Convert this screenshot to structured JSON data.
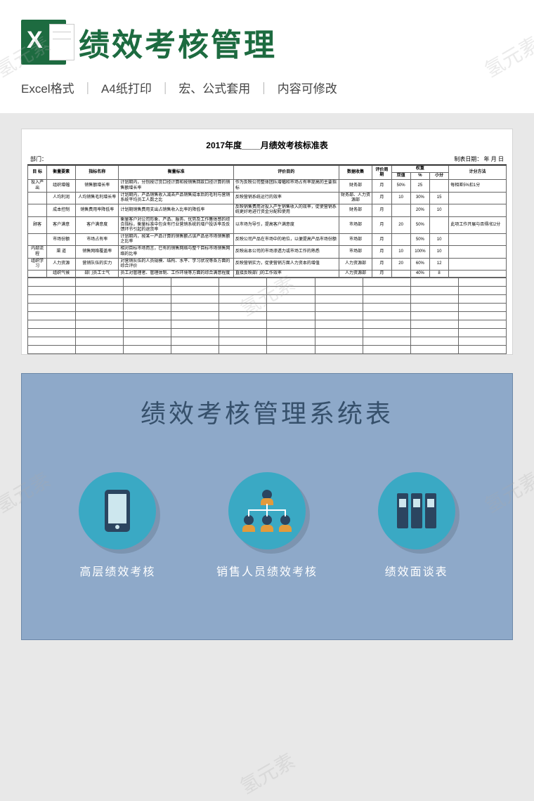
{
  "watermark": "氢元素",
  "header": {
    "icon_letter": "X",
    "title": "绩效考核管理"
  },
  "subhead": {
    "p1": "Excel格式",
    "p2": "A4纸打印",
    "p3": "宏、公式套用",
    "p4": "内容可修改"
  },
  "sheet": {
    "title": "2017年度____月绩效考核标准表",
    "dept_label": "部门：",
    "date_label": "制表日期：      年    月    日",
    "head": {
      "c1": "目 标",
      "c2": "衡量要素",
      "c3": "指标名称",
      "c4": "衡量标准",
      "c5": "评价目的",
      "c6": "数据收集",
      "c7": "评价周期",
      "c8": "权重",
      "c8a": "双值",
      "c8b": "%",
      "c8c": "小分",
      "c9": "计分方法"
    },
    "rows": [
      {
        "g": "投入产出",
        "a": "组织增幅",
        "b": "销售额增长率",
        "c": "计划期内，分别按订货口径计算和按销售回款口径计算的销售额增长率",
        "d": "作为反映公司整体团队增幅和市场占有率提高的主要指标",
        "e": "财务部",
        "f": "月",
        "w1": "50%",
        "w2": "25",
        "m": "每相差5%扣1分"
      },
      {
        "g": "",
        "a": "人均利润",
        "b": "人均销售毛利增长率",
        "c": "计划期内，产品销售收入减去产品销售成本后的毛利与营销系统平均员工人数之比",
        "d": "反映营销系统运行的效率",
        "e": "财务部、人力资源部",
        "f": "月",
        "w1": "10",
        "w2": "30%",
        "m": "15"
      },
      {
        "g": "",
        "a": "成本控制",
        "b": "销售费用率降低率",
        "c": "计划期销售费用支出占销售收入比率的降低率",
        "d": "反映销售费用对投入产生销售收入的效率，促使营销系统更好地进行资金分配和使用",
        "e": "财务部",
        "f": "月",
        "w1": "",
        "w2": "20%",
        "m": "10"
      },
      {
        "g": "顾客",
        "a": "客户满意",
        "b": "客户满意度",
        "c": "衡量客户对公司形象、产品、服务、优势及工作集体感的综合指标，衡量标准中包含有行业营销系统的增户投诉率及反馈环节引起的退货率",
        "d": "以市场为导引，提高客户满意度",
        "e": "市场部",
        "f": "月",
        "w1": "20",
        "w2": "50%",
        "m": "此项工作开展与否得/扣2分"
      },
      {
        "g": "",
        "a": "市场份额",
        "b": "市场占有率",
        "c": "计划期内，按某一产品计算的销售额占该产品总市场销售额之比率",
        "d": "反映公司产品在市场中的地位，以便提高产品市场份额",
        "e": "市场部",
        "f": "月",
        "w1": "",
        "w2": "50%",
        "m": "10"
      },
      {
        "g": "内部流程",
        "a": "渠 道",
        "b": "销售网络覆盖率",
        "c": "相对目标市场而言，已有的销售网络与整个目标市场销售网络的比率",
        "d": "反映出本公司的市场渗透力或市场工作的熟悉",
        "e": "市场部",
        "f": "月",
        "w1": "10",
        "w2": "100%",
        "m": "10"
      },
      {
        "g": "组织学习",
        "a": "人力资源",
        "b": "营销队伍的实力",
        "c": "对营销队伍的人员规模、结构、水平、学习状况等各方面的综合评价",
        "d": "反映营销实力，促使营销方面人力资本的增值",
        "e": "人力资源部",
        "f": "月",
        "w1": "20",
        "w2": "60%",
        "m": "12"
      },
      {
        "g": "",
        "a": "组织气候",
        "b": "部门员工士气",
        "c": "员工对管理者、管理体制、工作环境等方面的综合满意程度",
        "d": "直接反映部门的工作效率",
        "e": "人力资源部",
        "f": "月",
        "w1": "",
        "w2": "40%",
        "m": "8"
      }
    ]
  },
  "bluecard": {
    "title": "绩效考核管理系统表",
    "items": [
      {
        "label": "高层绩效考核"
      },
      {
        "label": "销售人员绩效考核"
      },
      {
        "label": "绩效面谈表"
      }
    ]
  }
}
